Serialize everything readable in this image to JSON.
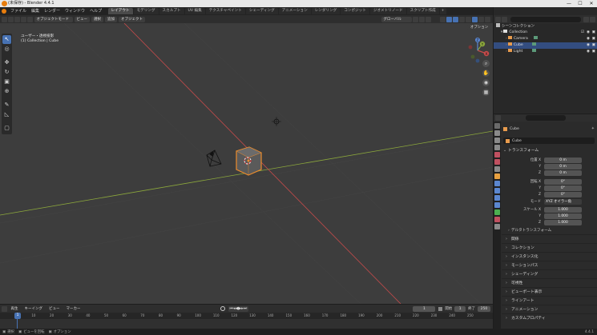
{
  "window": {
    "title": "(未保存) - Blender 4.4.1",
    "controls": [
      "—",
      "☐",
      "✕"
    ]
  },
  "menu": {
    "items": [
      "ファイル",
      "編集",
      "レンダー",
      "ウィンドウ",
      "ヘルプ"
    ],
    "workspaces": [
      "レイアウト",
      "モデリング",
      "スカルプト",
      "UV 編集",
      "テクスチャペイント",
      "シェーディング",
      "アニメーション",
      "レンダリング",
      "コンポジット",
      "ジオメトリノード",
      "スクリプト作成"
    ],
    "active_workspace": 0,
    "more_tabs_label": "+",
    "scene": "Scene",
    "view_layer": "ViewLayer"
  },
  "viewport_header": {
    "mode": "オブジェクトモード",
    "menus": [
      "ビュー",
      "選択",
      "追加",
      "オブジェクト"
    ],
    "transform_orientation": "グローバル",
    "options_label": "オプション"
  },
  "viewport": {
    "overlay_line1": "ユーザー・透視投影",
    "overlay_line2": "(1) Collection | Cube",
    "gizmo_axes": [
      "X",
      "Y",
      "Z"
    ],
    "colors": {
      "x_axis": "#c84b4b",
      "y_axis": "#8ca83c",
      "z_axis": "#5b87d0",
      "selection": "#ec8c2c"
    }
  },
  "outliner": {
    "search_placeholder": "",
    "rows": [
      {
        "label": "シーンコレクション",
        "indent": 0,
        "icon": "scene-collection-icon"
      },
      {
        "label": "Collection",
        "indent": 1,
        "icon": "collection-icon"
      },
      {
        "label": "Camera",
        "indent": 2,
        "icon": "camera-icon"
      },
      {
        "label": "Cube",
        "indent": 2,
        "icon": "mesh-icon",
        "selected": true
      },
      {
        "label": "Light",
        "indent": 2,
        "icon": "light-icon"
      }
    ]
  },
  "properties": {
    "search_placeholder": "",
    "object_name": "Cube",
    "object_field": "Cube",
    "transform_title": "トランスフォーム",
    "location_label": "位置 X",
    "rotation_label": "回転 X",
    "scale_label": "スケール X",
    "axis_y": "Y",
    "axis_z": "Z",
    "location": [
      "0 m",
      "0 m",
      "0 m"
    ],
    "rotation": [
      "0°",
      "0°",
      "0°"
    ],
    "mode_label": "モード",
    "mode_value": "XYZ オイラー角",
    "scale": [
      "1.000",
      "1.000",
      "1.000"
    ],
    "delta_title": "デルタトランスフォーム",
    "sections": [
      "関係",
      "コレクション",
      "インスタンス化",
      "モーションパス",
      "シェーディング",
      "可視性",
      "ビューポート表示",
      "ラインアート",
      "アニメーション",
      "カスタムプロパティ"
    ]
  },
  "timeline": {
    "menus": [
      "再生",
      "キーイング",
      "ビュー",
      "マーカー"
    ],
    "current_frame": "1",
    "start_label": "開始",
    "start": "1",
    "end_label": "終了",
    "end": "250",
    "ticks": [
      "1",
      "10",
      "20",
      "30",
      "40",
      "50",
      "60",
      "70",
      "80",
      "90",
      "100",
      "110",
      "120",
      "130",
      "140",
      "150",
      "160",
      "170",
      "180",
      "190",
      "200",
      "210",
      "220",
      "230",
      "240",
      "250"
    ]
  },
  "status": {
    "select": "選択",
    "rotate": "ビューを回転",
    "options": "オプション",
    "version": "4.4.1"
  }
}
